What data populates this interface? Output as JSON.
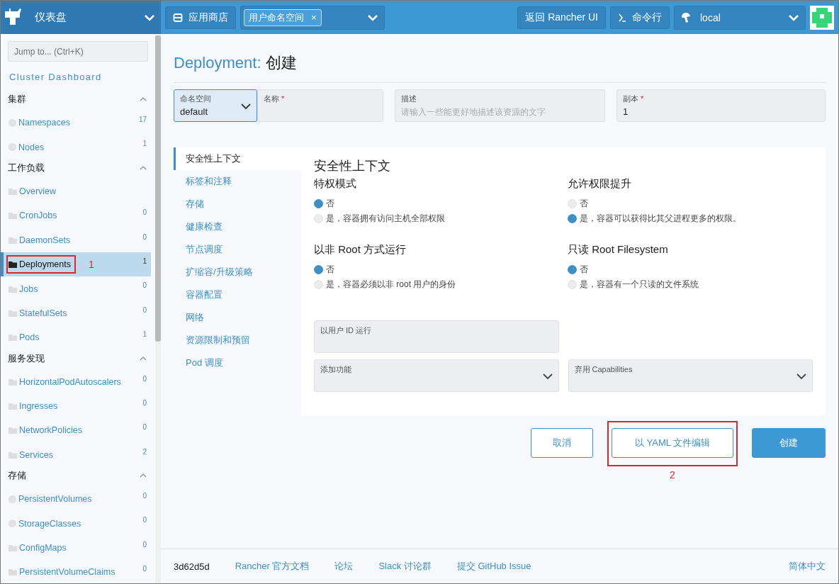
{
  "header": {
    "title": "仪表盘",
    "app_store": "应用商店",
    "namespace_tag": "用户命名空间",
    "namespace_tag_remove": "×",
    "back_button": "返回 Rancher UI",
    "shell_button": "命令行",
    "cluster": "local"
  },
  "sidebar": {
    "search": {
      "placeholder": "Jump to... (Ctrl+K)"
    },
    "dashboard_link": "Cluster Dashboard",
    "groups": [
      {
        "title": "集群",
        "expanded": true,
        "items": [
          {
            "kind": "circle",
            "label": "Namespaces",
            "count": "17",
            "selected": false
          },
          {
            "kind": "circle",
            "label": "Nodes",
            "count": "1",
            "selected": false
          }
        ]
      },
      {
        "title": "工作负载",
        "expanded": true,
        "items": [
          {
            "kind": "folder",
            "label": "Overview",
            "selected": false
          },
          {
            "kind": "folder",
            "label": "CronJobs",
            "count": "0",
            "selected": false
          },
          {
            "kind": "folder",
            "label": "DaemonSets",
            "count": "0",
            "selected": false
          },
          {
            "kind": "folder",
            "label": "Deployments",
            "count": "1",
            "selected": true,
            "annotation": "1"
          },
          {
            "kind": "folder",
            "label": "Jobs",
            "count": "0",
            "selected": false
          },
          {
            "kind": "folder",
            "label": "StatefulSets",
            "count": "0",
            "selected": false
          },
          {
            "kind": "folder",
            "label": "Pods",
            "count": "1",
            "selected": false
          }
        ]
      },
      {
        "title": "服务发现",
        "expanded": true,
        "items": [
          {
            "kind": "folder",
            "label": "HorizontalPodAutoscalers",
            "count": "0",
            "selected": false
          },
          {
            "kind": "folder",
            "label": "Ingresses",
            "count": "0",
            "selected": false
          },
          {
            "kind": "folder",
            "label": "NetworkPolicies",
            "count": "0",
            "selected": false
          },
          {
            "kind": "folder",
            "label": "Services",
            "count": "2",
            "selected": false
          }
        ]
      },
      {
        "title": "存储",
        "expanded": true,
        "items": [
          {
            "kind": "circle",
            "label": "PersistentVolumes",
            "count": "0",
            "selected": false
          },
          {
            "kind": "circle",
            "label": "StorageClasses",
            "count": "0",
            "selected": false
          },
          {
            "kind": "folder",
            "label": "ConfigMaps",
            "count": "0",
            "selected": false
          },
          {
            "kind": "folder",
            "label": "PersistentVolumeClaims",
            "count": "0",
            "selected": false
          }
        ]
      }
    ]
  },
  "page": {
    "title_prefix": "Deployment:",
    "title": "创建",
    "fields": [
      {
        "kind": "select",
        "label": "命名空间",
        "value": "default"
      },
      {
        "kind": "input",
        "label": "名称",
        "required_mark": "*"
      },
      {
        "kind": "input",
        "label": "描述",
        "placeholder": "请输入一些能更好地描述该资源的文字"
      },
      {
        "kind": "input",
        "label": "副本",
        "required_mark": "*",
        "value": "1"
      }
    ],
    "tabs": [
      {
        "label": "安全性上下文",
        "selected": true
      },
      {
        "label": "标签和注释",
        "selected": false
      },
      {
        "label": "存储",
        "selected": false
      },
      {
        "label": "健康检查",
        "selected": false
      },
      {
        "label": "节点调度",
        "selected": false
      },
      {
        "label": "扩缩容/升级策略",
        "selected": false
      },
      {
        "label": "容器配置",
        "selected": false
      },
      {
        "label": "网络",
        "selected": false
      },
      {
        "label": "资源限制和预留",
        "selected": false
      },
      {
        "label": "Pod 调度",
        "selected": false
      }
    ],
    "section_title": "安全性上下文",
    "radio_groups": [
      {
        "title": "特权模式",
        "options": [
          {
            "label": "否",
            "selected": true
          },
          {
            "label": "是，容器拥有访问主机全部权限",
            "selected": false
          }
        ]
      },
      {
        "title": "允许权限提升",
        "options": [
          {
            "label": "否",
            "selected": false
          },
          {
            "label": "是，容器可以获得比其父进程更多的权限。",
            "selected": true
          }
        ]
      },
      {
        "title": "以非 Root 方式运行",
        "options": [
          {
            "label": "否",
            "selected": true
          },
          {
            "label": "是，容器必须以非 root 用户的身份",
            "selected": false
          }
        ]
      },
      {
        "title": "只读 Root Filesystem",
        "options": [
          {
            "label": "否",
            "selected": true
          },
          {
            "label": "是，容器有一个只读的文件系统",
            "selected": false
          }
        ]
      }
    ],
    "run_as_user": {
      "label": "以用户 ID 运行"
    },
    "capabilities": [
      {
        "label": "添加功能"
      },
      {
        "label": "弃用 Capabilities"
      }
    ],
    "buttons": [
      {
        "kind": "outline",
        "label": "取消"
      },
      {
        "kind": "outline",
        "label": "以 YAML 文件编辑",
        "annotation": "2"
      },
      {
        "kind": "primary",
        "label": "创建"
      }
    ]
  },
  "footer": {
    "version": "3d62d5d",
    "links": [
      "Rancher 官方文档",
      "论坛",
      "Slack 讨论群",
      "提交 GitHub Issue"
    ],
    "language": "简体中文"
  }
}
